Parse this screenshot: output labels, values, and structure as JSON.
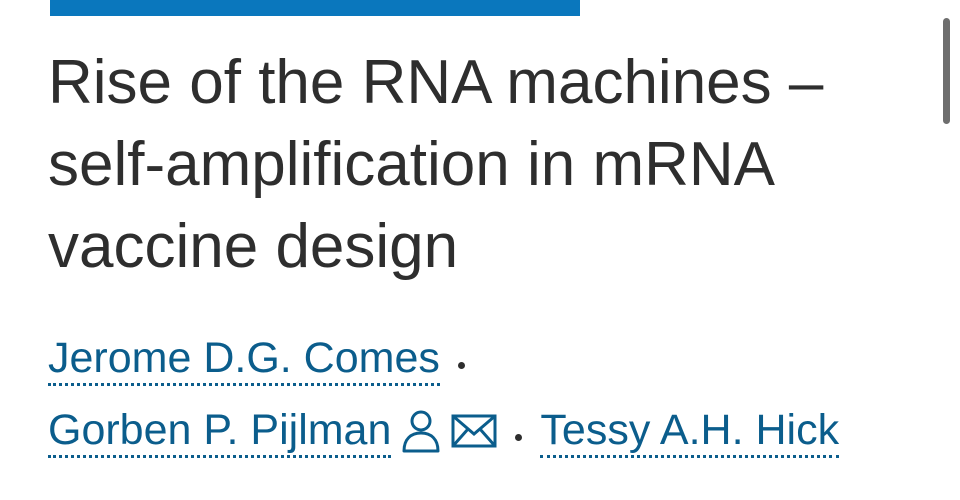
{
  "header": {
    "accent_color": "#0a77bd"
  },
  "article": {
    "title_lines": [
      "Rise of the RNA machines –",
      "self-amplification in mRNA",
      "vaccine design"
    ],
    "authors": [
      {
        "name": "Jerome D.G. Comes"
      },
      {
        "name": "Gorben P. Pijlman",
        "icons": [
          "person-icon",
          "envelope-icon"
        ]
      },
      {
        "name": "Tessy A.H. Hick"
      }
    ],
    "link_color": "#0b5d8c"
  }
}
